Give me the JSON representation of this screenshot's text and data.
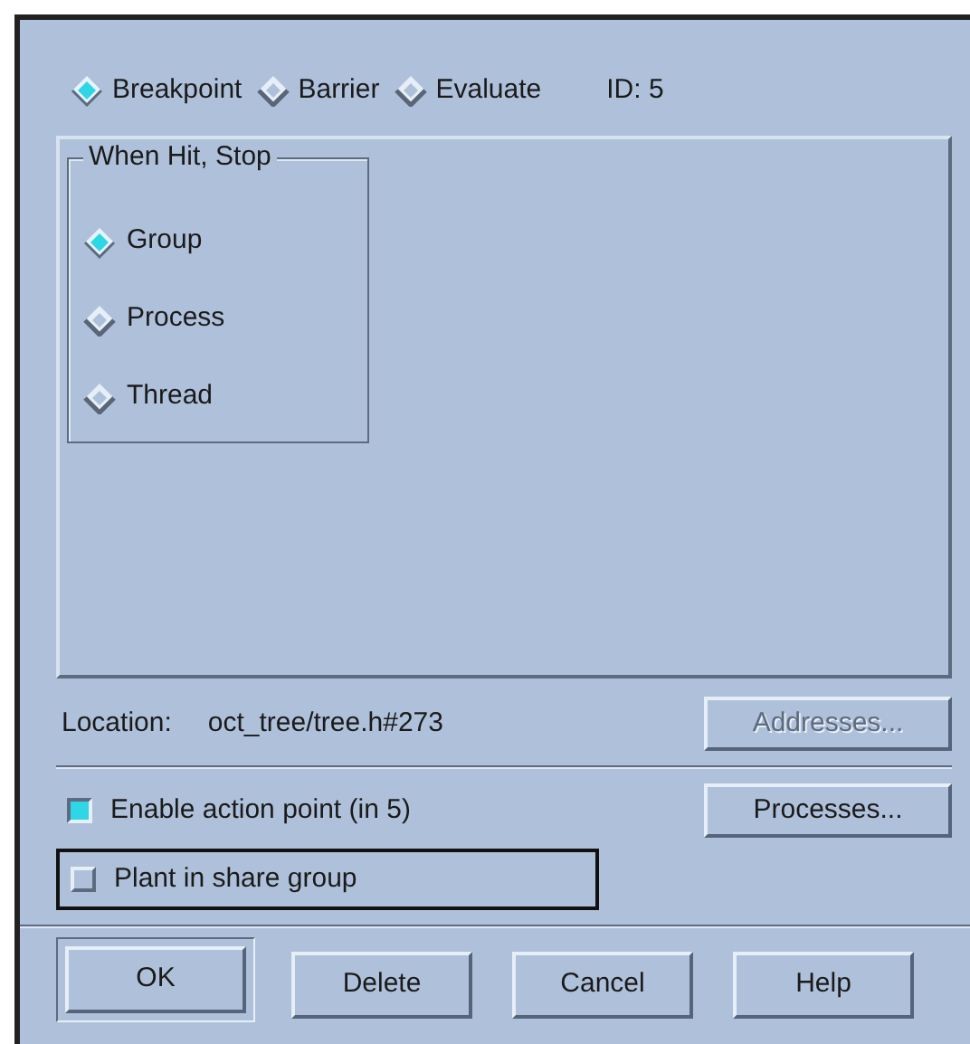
{
  "type_options": [
    {
      "label": "Breakpoint",
      "selected": true
    },
    {
      "label": "Barrier",
      "selected": false
    },
    {
      "label": "Evaluate",
      "selected": false
    }
  ],
  "id_label": "ID: 5",
  "stop_group": {
    "title": "When Hit, Stop",
    "options": [
      {
        "label": "Group",
        "selected": true
      },
      {
        "label": "Process",
        "selected": false
      },
      {
        "label": "Thread",
        "selected": false
      }
    ]
  },
  "location": {
    "label": "Location:",
    "value": "oct_tree/tree.h#273"
  },
  "addresses_button": {
    "label": "Addresses...",
    "disabled": true
  },
  "enable": {
    "label": "Enable action point (in 5)",
    "checked": true
  },
  "processes_button": {
    "label": "Processes...",
    "disabled": false
  },
  "plant": {
    "label": "Plant in share group",
    "checked": false,
    "focused": true
  },
  "buttons": [
    {
      "label": "OK",
      "default": true
    },
    {
      "label": "Delete",
      "default": false
    },
    {
      "label": "Cancel",
      "default": false
    },
    {
      "label": "Help",
      "default": false
    }
  ]
}
